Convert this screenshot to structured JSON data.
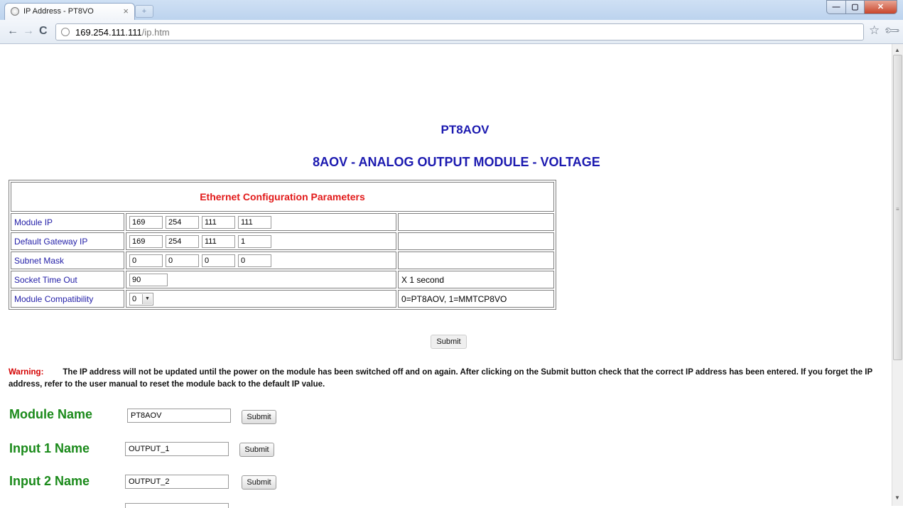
{
  "browser": {
    "tab_title": "IP Address - PT8VO",
    "tab_close": "×",
    "url_host": "169.254.111.111",
    "url_path": "/ip.htm"
  },
  "page": {
    "title": "PT8AOV",
    "subtitle": "8AOV - ANALOG OUTPUT MODULE - VOLTAGE"
  },
  "config": {
    "header": "Ethernet Configuration Parameters",
    "rows": [
      {
        "label": "Module IP",
        "octets": [
          "169",
          "254",
          "111",
          "111"
        ],
        "note": ""
      },
      {
        "label": "Default Gateway IP",
        "octets": [
          "169",
          "254",
          "111",
          "1"
        ],
        "note": ""
      },
      {
        "label": "Subnet Mask",
        "octets": [
          "0",
          "0",
          "0",
          "0"
        ],
        "note": ""
      },
      {
        "label": "Socket Time Out",
        "value": "90",
        "note": "X 1 second"
      },
      {
        "label": "Module Compatibility",
        "selected": "0",
        "note": "0=PT8AOV,  1=MMTCP8VO"
      }
    ],
    "submit_label": "Submit"
  },
  "warning": {
    "label": "Warning:",
    "text": "The IP address will not be updated until the power on the module has been switched off and on again. After clicking on the Submit button check that the correct IP address has been entered. If you forget the IP address, refer to the user manual to reset the module back to the default IP value."
  },
  "names": [
    {
      "label": "Module Name",
      "value": "PT8AOV",
      "submit": "Submit"
    },
    {
      "label": "Input 1 Name",
      "value": "OUTPUT_1",
      "submit": "Submit"
    },
    {
      "label": "Input 2 Name",
      "value": "OUTPUT_2",
      "submit": "Submit"
    }
  ],
  "colors": {
    "heading_blue": "#1c1ab0",
    "label_blue": "#2420a8",
    "config_header_red": "#e21a1a",
    "warning_red": "#d40000",
    "name_green": "#1a8a1a"
  }
}
